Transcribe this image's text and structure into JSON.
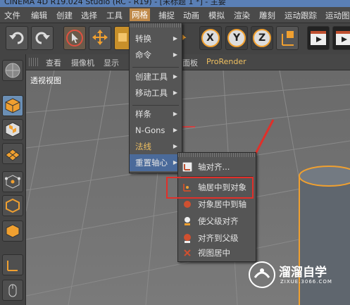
{
  "window": {
    "title": "CINEMA 4D R19.024 Studio (RC - R19) - [未标题 1 *] - 主要"
  },
  "menubar": {
    "items": [
      "文件",
      "编辑",
      "创建",
      "选择",
      "工具",
      "网格",
      "捕捉",
      "动画",
      "模拟",
      "渲染",
      "雕刻",
      "运动跟踪",
      "运动图"
    ],
    "active": "网格"
  },
  "viewbar": {
    "items": [
      "查看",
      "摄像机",
      "显示"
    ],
    "panel": "面板",
    "prorender": "ProRender"
  },
  "viewport": {
    "label": "透视视图"
  },
  "mesh_menu": {
    "items": [
      "转换",
      "命令",
      "创建工具",
      "移动工具",
      "样条",
      "N-Gons",
      "法线",
      "重置轴心"
    ],
    "highlighted": "重置轴心"
  },
  "axis_submenu": {
    "items": [
      "轴对齐...",
      "轴居中到对象",
      "对象居中到轴",
      "使父级对齐",
      "对齐到父级",
      "视图居中"
    ],
    "boxed": "轴居中到对象"
  },
  "toolbar": {
    "axis_labels": [
      "X",
      "Y",
      "Z"
    ]
  },
  "watermark": {
    "name": "溜溜自学",
    "url": "ZIXUE.3066.COM"
  },
  "colors": {
    "accent": "#c08a4a",
    "highlight_box": "#e0302a",
    "selection": "#4a6a9a"
  }
}
